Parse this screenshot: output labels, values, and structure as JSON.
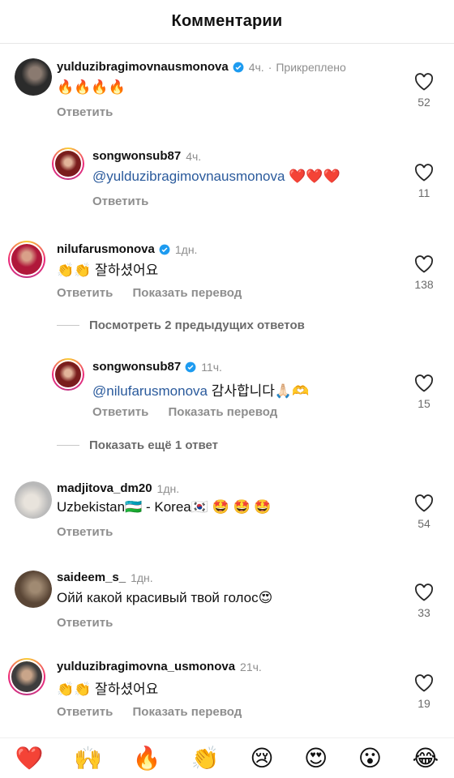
{
  "header": {
    "title": "Комментарии"
  },
  "comments": [
    {
      "user": "yulduzibragimovnausmonova",
      "verified": true,
      "time": "4ч.",
      "pinned": "Прикреплено",
      "text": "🔥🔥🔥🔥",
      "actions": [
        "Ответить"
      ],
      "likes": "52",
      "avatar_color": "#2b2b2b"
    },
    {
      "user": "songwonsub87",
      "verified": false,
      "time": "4ч.",
      "mention": "@yulduzibragimovnausmonova",
      "text": " ❤️❤️❤️",
      "actions": [
        "Ответить"
      ],
      "likes": "11",
      "avatar_color": "#7a1d1d"
    },
    {
      "user": "nilufarusmonova",
      "verified": true,
      "time": "1дн.",
      "text": "👏👏 잘하셨어요",
      "actions": [
        "Ответить",
        "Показать перевод"
      ],
      "likes": "138",
      "avatar_color": "#b0183a"
    },
    {
      "user": "songwonsub87",
      "verified": true,
      "time": "11ч.",
      "mention": "@nilufarusmonova",
      "text": " 감사합니다🙏🏻🫶",
      "actions": [
        "Ответить",
        "Показать перевод"
      ],
      "likes": "15",
      "avatar_color": "#7a1d1d"
    },
    {
      "user": "madjitova_dm20",
      "verified": false,
      "time": "1дн.",
      "text": "Uzbekistan🇺🇿 - Korea🇰🇷 🤩 🤩 🤩",
      "actions": [
        "Ответить"
      ],
      "likes": "54",
      "avatar_color": "#b9b9b9"
    },
    {
      "user": "saideem_s_",
      "verified": false,
      "time": "1дн.",
      "text": "Ойй какой красивый твой голос😍",
      "actions": [
        "Ответить"
      ],
      "likes": "33",
      "avatar_color": "#5a4636"
    },
    {
      "user": "yulduzibragimovna_usmonova",
      "verified": false,
      "time": "21ч.",
      "text": "👏👏 잘하셨어요",
      "actions": [
        "Ответить",
        "Показать перевод"
      ],
      "likes": "19",
      "avatar_color": "#3d3d3d"
    }
  ],
  "view_more": {
    "previous": "Посмотреть 2 предыдущих ответов",
    "more": "Показать ещё 1 ответ"
  },
  "reactions": [
    "❤️",
    "🙌",
    "🔥",
    "👏",
    "😢",
    "😍",
    "😮",
    "😂"
  ],
  "colors": {
    "mention": "#2a5a9c",
    "verified": "#1d9bf0",
    "muted": "#8e8e8e"
  }
}
